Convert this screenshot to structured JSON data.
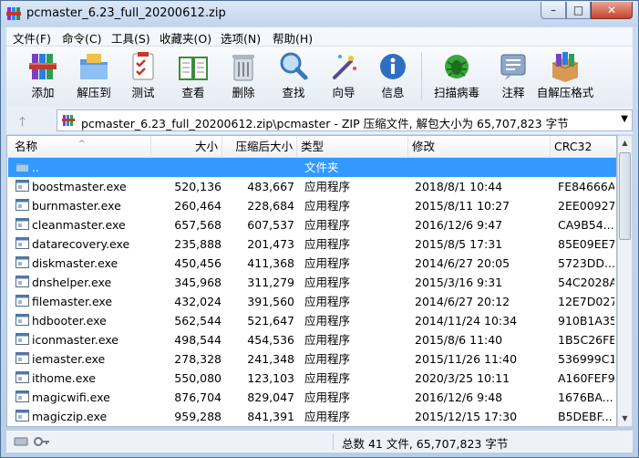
{
  "window": {
    "title": "pcmaster_6.23_full_20200612.zip",
    "min": "–",
    "max": "□",
    "close": "✕"
  },
  "menu": [
    "文件(F)",
    "命令(C)",
    "工具(S)",
    "收藏夹(O)",
    "选项(N)",
    "帮助(H)"
  ],
  "toolbar": [
    {
      "label": "添加",
      "icon": "add-archive-icon"
    },
    {
      "label": "解压到",
      "icon": "extract-folder-icon"
    },
    {
      "label": "测试",
      "icon": "test-checklist-icon"
    },
    {
      "label": "查看",
      "icon": "view-book-icon"
    },
    {
      "label": "删除",
      "icon": "delete-trash-icon"
    },
    {
      "label": "查找",
      "icon": "find-magnifier-icon"
    },
    {
      "label": "向导",
      "icon": "wizard-wand-icon"
    },
    {
      "label": "信息",
      "icon": "info-icon"
    },
    {
      "label": "扫描病毒",
      "icon": "virus-scan-icon"
    },
    {
      "label": "注释",
      "icon": "comment-icon"
    },
    {
      "label": "自解压格式",
      "icon": "sfx-box-icon"
    }
  ],
  "address": {
    "path": "pcmaster_6.23_full_20200612.zip\\pcmaster - ZIP 压缩文件, 解包大小为 65,707,823 字节",
    "up": "🡑",
    "drop": "▼"
  },
  "columns": {
    "name": "名称",
    "size": "大小",
    "packed": "压缩后大小",
    "type": "类型",
    "modified": "修改",
    "crc": "CRC32"
  },
  "rows": [
    {
      "name": "..",
      "size": "",
      "packed": "",
      "type": "文件夹",
      "modified": "",
      "crc": ""
    },
    {
      "name": "boostmaster.exe",
      "size": "520,136",
      "packed": "483,667",
      "type": "应用程序",
      "modified": "2018/8/1 10:44",
      "crc": "FE84666A"
    },
    {
      "name": "burnmaster.exe",
      "size": "260,464",
      "packed": "228,684",
      "type": "应用程序",
      "modified": "2015/8/11 10:27",
      "crc": "2EE00927"
    },
    {
      "name": "cleanmaster.exe",
      "size": "657,568",
      "packed": "607,537",
      "type": "应用程序",
      "modified": "2016/12/6 9:47",
      "crc": "CA9B54..."
    },
    {
      "name": "datarecovery.exe",
      "size": "235,888",
      "packed": "201,473",
      "type": "应用程序",
      "modified": "2015/8/5 17:31",
      "crc": "85E09EE7"
    },
    {
      "name": "diskmaster.exe",
      "size": "450,456",
      "packed": "411,368",
      "type": "应用程序",
      "modified": "2014/6/27 20:05",
      "crc": "5723DD..."
    },
    {
      "name": "dnshelper.exe",
      "size": "345,968",
      "packed": "311,279",
      "type": "应用程序",
      "modified": "2015/3/16 9:31",
      "crc": "54C2028A"
    },
    {
      "name": "filemaster.exe",
      "size": "432,024",
      "packed": "391,560",
      "type": "应用程序",
      "modified": "2014/6/27 20:12",
      "crc": "12E7D027"
    },
    {
      "name": "hdbooter.exe",
      "size": "562,544",
      "packed": "521,647",
      "type": "应用程序",
      "modified": "2014/11/24 10:34",
      "crc": "910B1A35"
    },
    {
      "name": "iconmaster.exe",
      "size": "498,544",
      "packed": "454,536",
      "type": "应用程序",
      "modified": "2015/8/6 11:40",
      "crc": "1B5C26FE"
    },
    {
      "name": "iemaster.exe",
      "size": "278,328",
      "packed": "241,348",
      "type": "应用程序",
      "modified": "2015/11/26 11:40",
      "crc": "536999C1"
    },
    {
      "name": "ithome.exe",
      "size": "550,080",
      "packed": "123,103",
      "type": "应用程序",
      "modified": "2020/3/25 10:11",
      "crc": "A160FEF9"
    },
    {
      "name": "magicwifi.exe",
      "size": "876,704",
      "packed": "829,047",
      "type": "应用程序",
      "modified": "2016/12/6 9:48",
      "crc": "1676BA..."
    },
    {
      "name": "magiczip.exe",
      "size": "959,288",
      "packed": "841,391",
      "type": "应用程序",
      "modified": "2015/12/15 17:30",
      "crc": "B5DEBF..."
    }
  ],
  "status": {
    "summary": "总数 41 文件, 65,707,823 字节"
  },
  "colors": {
    "selection": "#3399ff",
    "titlebar": "#c1d5ee",
    "close": "#c7432b"
  }
}
